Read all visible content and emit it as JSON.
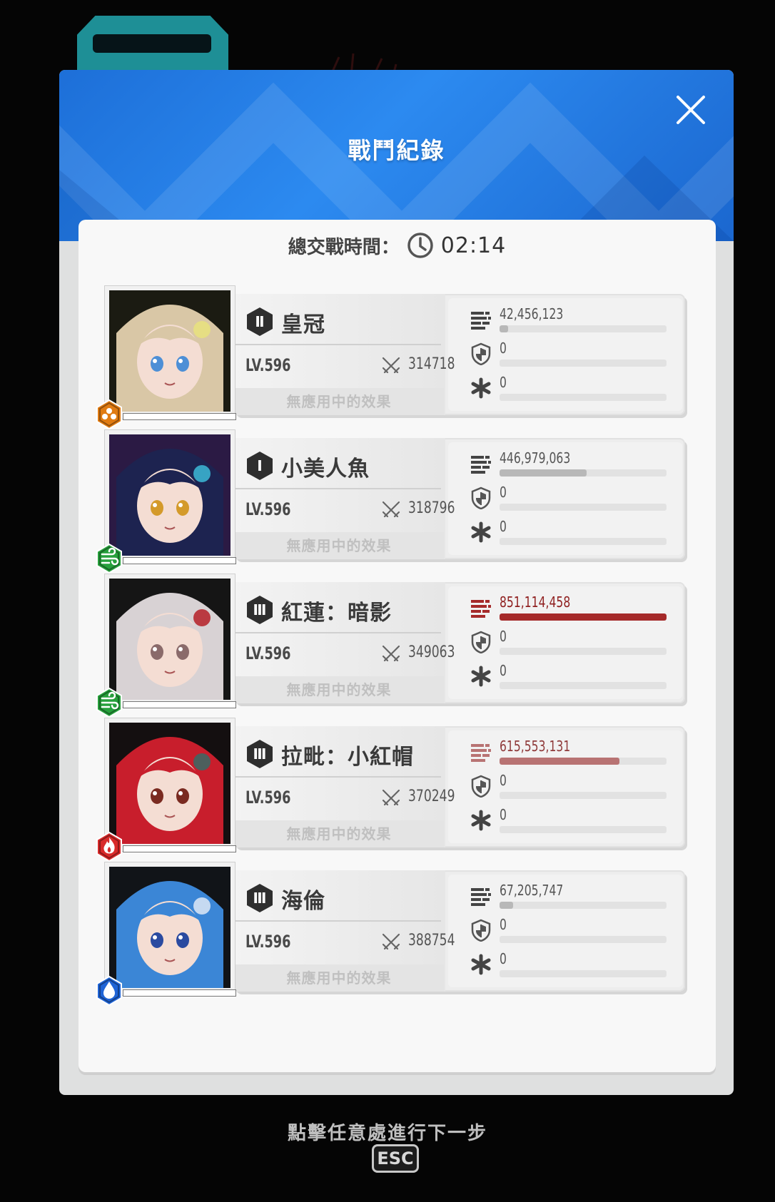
{
  "header": {
    "title": "戰鬥紀錄"
  },
  "summary": {
    "label": "總交戰時間：",
    "time": "02:14"
  },
  "colors": {
    "header_blue": "#2c8af0",
    "damage_red": "#a52a2a",
    "damage_pink": "#b87373",
    "bar_gray": "#b8b8b8"
  },
  "characters": [
    {
      "rank": "Ⅱ",
      "name": "皇冠",
      "level": "LV.596",
      "power": "314718",
      "effect": "無應用中的效果",
      "element": "hex-burst-icon",
      "element_color": "#e07b12",
      "damage": "42,456,123",
      "damage_fill": 0.05,
      "damage_color": "#b8b8b8",
      "shield": "0",
      "heal": "0"
    },
    {
      "rank": "Ⅰ",
      "name": "小美人魚",
      "level": "LV.596",
      "power": "318796",
      "effect": "無應用中的效果",
      "element": "wind-icon",
      "element_color": "#27a03c",
      "damage": "446,979,063",
      "damage_fill": 0.52,
      "damage_color": "#b8b8b8",
      "shield": "0",
      "heal": "0"
    },
    {
      "rank": "Ⅲ",
      "name": "紅蓮：暗影",
      "level": "LV.596",
      "power": "349063",
      "effect": "無應用中的效果",
      "element": "wind-icon",
      "element_color": "#27a03c",
      "damage": "851,114,458",
      "damage_fill": 1.0,
      "damage_color": "#a52a2a",
      "damage_text_color": "#8f1f1f",
      "shield": "0",
      "heal": "0"
    },
    {
      "rank": "Ⅲ",
      "name": "拉毗：小紅帽",
      "level": "LV.596",
      "power": "370249",
      "effect": "無應用中的效果",
      "element": "fire-icon",
      "element_color": "#d82a2a",
      "damage": "615,553,131",
      "damage_fill": 0.72,
      "damage_color": "#b87373",
      "damage_text_color": "#8f3a3a",
      "shield": "0",
      "heal": "0"
    },
    {
      "rank": "Ⅲ",
      "name": "海倫",
      "level": "LV.596",
      "power": "388754",
      "effect": "無應用中的效果",
      "element": "water-icon",
      "element_color": "#1f64d6",
      "damage": "67,205,747",
      "damage_fill": 0.08,
      "damage_color": "#b8b8b8",
      "shield": "0",
      "heal": "0"
    }
  ],
  "footer": {
    "hint": "點擊任意處進行下一步",
    "esc_label": "ESC"
  }
}
